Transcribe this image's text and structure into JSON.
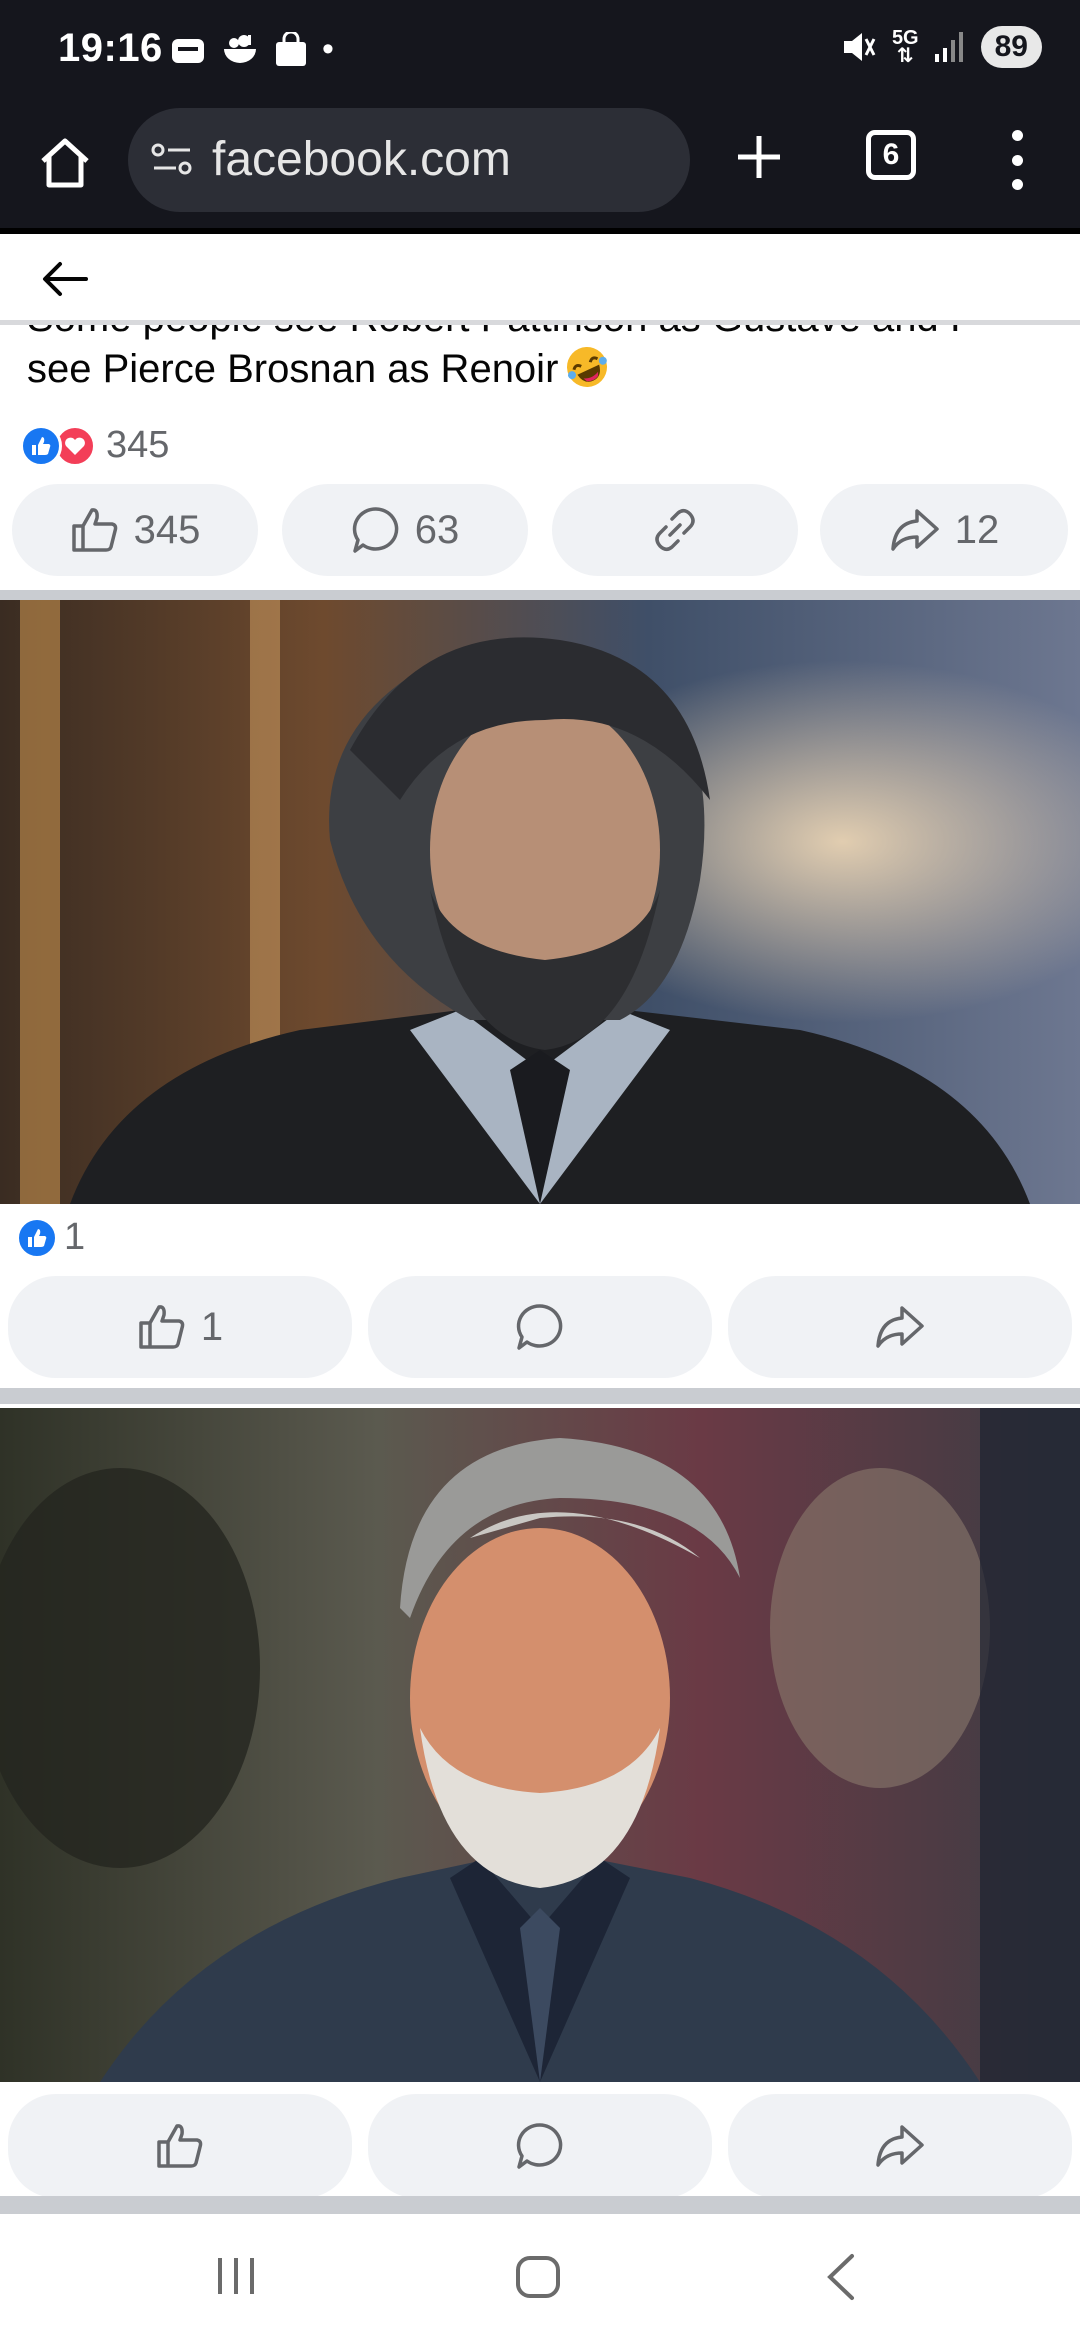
{
  "status_bar": {
    "time": "19:16",
    "dot": "•",
    "network": "5G",
    "battery": "89",
    "icons": [
      "wallet-icon",
      "cloud-bowl-icon",
      "shopping-bag-icon",
      "mute-icon",
      "signal-icon"
    ]
  },
  "browser": {
    "url": "facebook.com",
    "tab_count": "6",
    "icons": [
      "home-icon",
      "site-settings-icon",
      "plus-icon",
      "tabs-icon",
      "menu-dots-icon"
    ]
  },
  "page": {
    "back_icon": "arrow-left-icon",
    "post_text_cut": "Some people see Robert Pattinson as Gustave and I",
    "post_text": "see Pierce Brosnan as Renoir",
    "post_emoji": "rofl-emoji",
    "post_reaction_count": "345",
    "post_actions": {
      "like_count": "345",
      "comment_count": "63",
      "share_count": "12"
    },
    "photo1": {
      "description_icon": "photo-rendered-character",
      "reaction_count": "1",
      "like_count": "1"
    },
    "photo2": {
      "description_icon": "photo-pierce-brosnan"
    }
  },
  "colors": {
    "chrome_dark": "#15161d",
    "omnibox": "#2c2e36",
    "facebook_blue": "#1877f2",
    "love_red": "#f33e58",
    "pill_bg": "#f0f2f5",
    "secondary_text": "#65676b"
  }
}
